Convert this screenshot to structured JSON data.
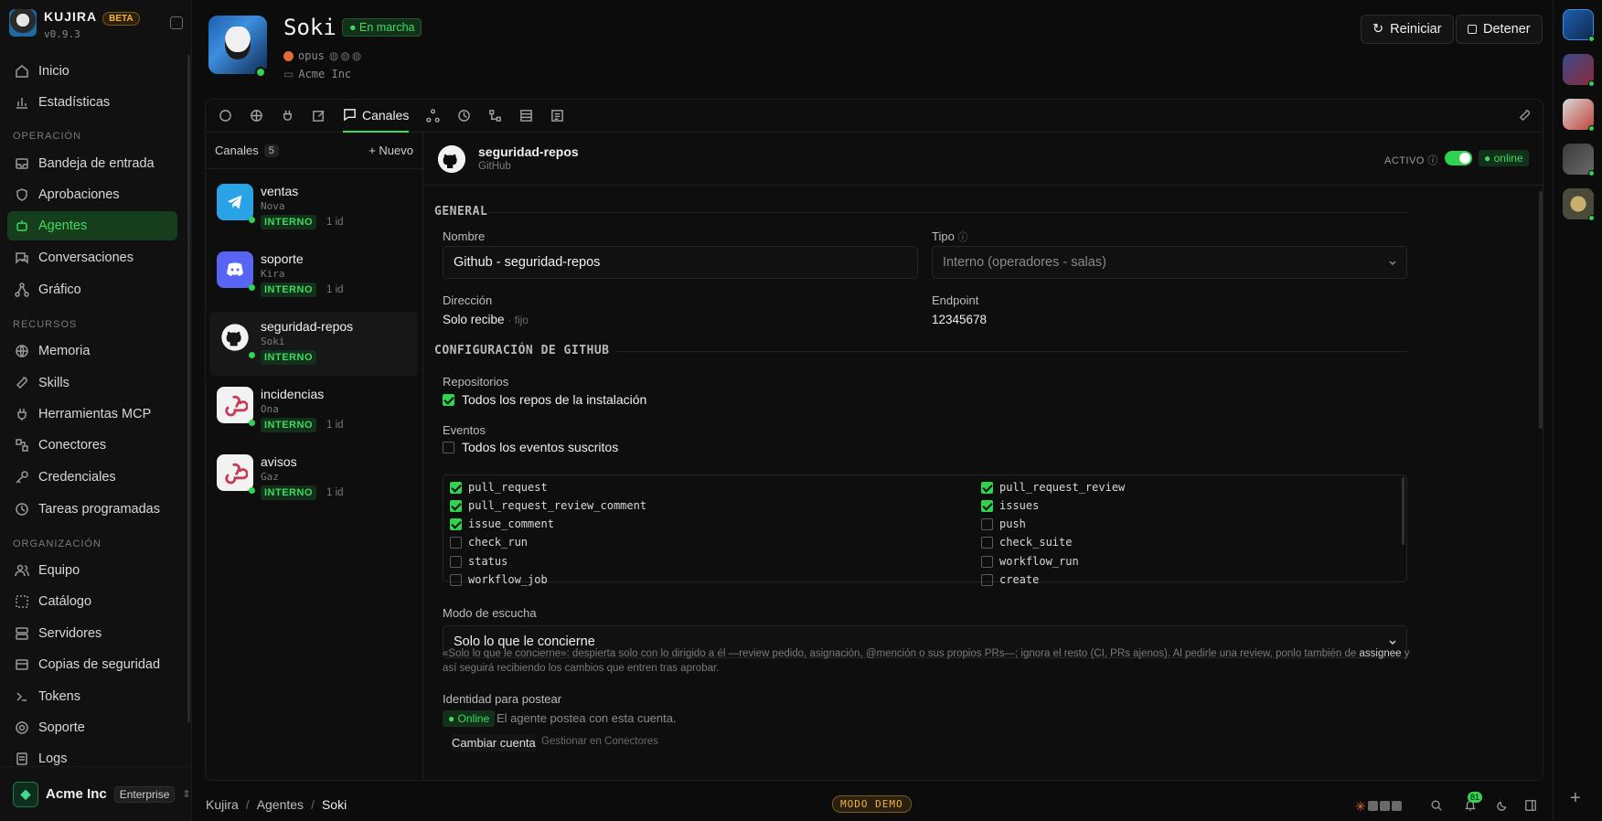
{
  "brand": {
    "name": "KUJIRA",
    "badge": "BETA",
    "version": "v0.9.3"
  },
  "nav": {
    "top": [
      {
        "label": "Inicio",
        "icon": "home-icon"
      },
      {
        "label": "Estadísticas",
        "icon": "bar-chart-icon"
      }
    ],
    "sections": [
      {
        "title": "OPERACIÓN",
        "items": [
          {
            "label": "Bandeja de entrada",
            "icon": "inbox-icon"
          },
          {
            "label": "Aprobaciones",
            "icon": "shield-icon"
          },
          {
            "label": "Agentes",
            "icon": "bot-icon",
            "active": true
          },
          {
            "label": "Conversaciones",
            "icon": "chat-icon"
          },
          {
            "label": "Gráfico",
            "icon": "graph-icon"
          }
        ]
      },
      {
        "title": "RECURSOS",
        "items": [
          {
            "label": "Memoria",
            "icon": "globe-icon"
          },
          {
            "label": "Skills",
            "icon": "wrench-icon"
          },
          {
            "label": "Herramientas MCP",
            "icon": "plug-icon"
          },
          {
            "label": "Conectores",
            "icon": "connector-icon"
          },
          {
            "label": "Credenciales",
            "icon": "key-icon"
          },
          {
            "label": "Tareas programadas",
            "icon": "clock-icon"
          }
        ]
      },
      {
        "title": "ORGANIZACIÓN",
        "items": [
          {
            "label": "Equipo",
            "icon": "users-icon"
          },
          {
            "label": "Catálogo",
            "icon": "catalog-icon"
          },
          {
            "label": "Servidores",
            "icon": "server-icon"
          },
          {
            "label": "Copias de seguridad",
            "icon": "backup-icon"
          },
          {
            "label": "Tokens",
            "icon": "terminal-icon"
          },
          {
            "label": "Soporte",
            "icon": "lifebuoy-icon"
          },
          {
            "label": "Logs",
            "icon": "logs-icon"
          }
        ]
      }
    ]
  },
  "org": {
    "name": "Acme Inc",
    "plan": "Enterprise"
  },
  "agent": {
    "name": "Soki",
    "status": "En marcha",
    "model": "opus",
    "org": "Acme Inc"
  },
  "actions": {
    "restart": "Reiniciar",
    "stop": "Detener"
  },
  "tabs": {
    "active_label": "Canales"
  },
  "channels": {
    "title": "Canales",
    "count": "5",
    "new_label": "Nuevo",
    "items": [
      {
        "name": "ventas",
        "owner": "Nova",
        "tag": "INTERNO",
        "age": "1 id"
      },
      {
        "name": "soporte",
        "owner": "Kira",
        "tag": "INTERNO",
        "age": "1 id"
      },
      {
        "name": "seguridad-repos",
        "owner": "Soki",
        "tag": "INTERNO",
        "age": ""
      },
      {
        "name": "incidencias",
        "owner": "Ona",
        "tag": "INTERNO",
        "age": "1 id"
      },
      {
        "name": "avisos",
        "owner": "Gaz",
        "tag": "INTERNO",
        "age": "1 id"
      }
    ]
  },
  "detail": {
    "title": "seguridad-repos",
    "provider": "GitHub",
    "active_label": "ACTIVO",
    "online_label": "online",
    "general_title": "GENERAL",
    "name_label": "Nombre",
    "name_value": "Github - seguridad-repos",
    "type_label": "Tipo",
    "type_value": "Interno (operadores - salas)",
    "direction_label": "Dirección",
    "direction_value": "Solo recibe",
    "direction_note": "· fijo",
    "endpoint_label": "Endpoint",
    "endpoint_value": "12345678",
    "github_title": "CONFIGURACIÓN DE GITHUB",
    "repos_label": "Repositorios",
    "repos_all": "Todos los repos de la instalación",
    "events_label": "Eventos",
    "events_all": "Todos los eventos suscritos",
    "events_left": [
      {
        "name": "pull_request",
        "on": true
      },
      {
        "name": "pull_request_review_comment",
        "on": true
      },
      {
        "name": "issue_comment",
        "on": true
      },
      {
        "name": "check_run",
        "on": false
      },
      {
        "name": "status",
        "on": false
      },
      {
        "name": "workflow_job",
        "on": false
      }
    ],
    "events_right": [
      {
        "name": "pull_request_review",
        "on": true
      },
      {
        "name": "issues",
        "on": true
      },
      {
        "name": "push",
        "on": false
      },
      {
        "name": "check_suite",
        "on": false
      },
      {
        "name": "workflow_run",
        "on": false
      },
      {
        "name": "create",
        "on": false
      }
    ],
    "listen_label": "Modo de escucha",
    "listen_value": "Solo lo que le concierne",
    "hint_1": "«Solo lo que le concierne»: despierta solo con lo dirigido a él —review pedido, asignación, @mención o sus propios PRs—; ignora el resto (CI, PRs ajenos). Al pedirle una review, ponlo también de",
    "hint_bold": "assignee",
    "hint_2": "y así seguirá recibiendo los cambios que entren tras aprobar.",
    "identity_label": "Identidad para postear",
    "identity_status": "Online",
    "identity_text": "El agente postea con esta cuenta.",
    "change_account": "Cambiar cuenta",
    "manage_link": "Gestionar en Conectores"
  },
  "breadcrumb": [
    "Kujira",
    "Agentes",
    "Soki"
  ],
  "demo_label": "MODO DEMO",
  "notifications_count": "81"
}
